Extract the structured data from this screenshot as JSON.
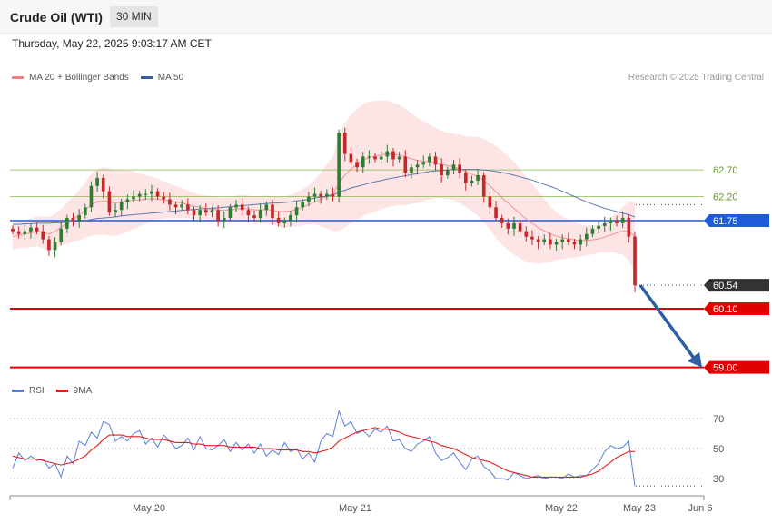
{
  "header": {
    "title": "Crude Oil (WTI)",
    "interval": "30 MIN",
    "datetime": "Thursday, May 22, 2025 9:03:17 AM CET"
  },
  "legend": {
    "ma20": "MA 20 + Bollinger Bands",
    "ma50": "MA 50",
    "ma20_color": "#f08080",
    "ma50_color": "#3a5fa0",
    "credit": "Research © 2025 Trading Central"
  },
  "rsi_legend": {
    "rsi": "RSI",
    "ma9": "9MA",
    "rsi_color": "#5b7fd6",
    "ma9_color": "#e02020"
  },
  "chart_data": [
    {
      "type": "candlestick",
      "title": "Crude Oil (WTI)",
      "interval": "30 MIN",
      "ylim": [
        58.85,
        63.95
      ],
      "x_tick_labels": [
        "May 20",
        "May 21",
        "May 22",
        "May 23",
        "Jun 6"
      ],
      "grid": false,
      "levels": [
        {
          "value": 62.7,
          "label": "62.70",
          "kind": "resistance",
          "color": "#7cb342"
        },
        {
          "value": 62.2,
          "label": "62.20",
          "kind": "resistance",
          "color": "#7cb342"
        },
        {
          "value": 61.75,
          "label": "61.75",
          "kind": "pivot",
          "color": "#1e5bd8"
        },
        {
          "value": 60.54,
          "label": "60.54",
          "kind": "last_price",
          "color": "#333333"
        },
        {
          "value": 60.1,
          "label": "60.10",
          "kind": "support",
          "color": "#e00000"
        },
        {
          "value": 59.0,
          "label": "59.00",
          "kind": "support",
          "color": "#e00000"
        }
      ],
      "close_series": [
        61.55,
        61.5,
        61.55,
        61.62,
        61.55,
        61.4,
        61.2,
        61.35,
        61.6,
        61.8,
        61.75,
        61.85,
        62.0,
        62.4,
        62.55,
        62.3,
        61.9,
        61.95,
        62.1,
        62.15,
        62.2,
        62.25,
        62.25,
        62.3,
        62.2,
        62.15,
        62.05,
        62.0,
        62.05,
        61.95,
        61.85,
        61.95,
        61.9,
        61.95,
        61.75,
        61.8,
        62.0,
        62.05,
        61.95,
        61.85,
        61.8,
        61.95,
        62.05,
        61.8,
        61.7,
        61.75,
        61.85,
        62.0,
        62.1,
        62.2,
        62.25,
        62.2,
        62.25,
        62.2,
        63.4,
        63.0,
        62.85,
        62.75,
        62.95,
        62.95,
        62.9,
        62.95,
        63.05,
        62.9,
        62.95,
        62.65,
        62.75,
        62.8,
        62.85,
        62.95,
        62.8,
        62.6,
        62.7,
        62.8,
        62.65,
        62.45,
        62.5,
        62.6,
        62.2,
        62.0,
        61.8,
        61.7,
        61.6,
        61.7,
        61.55,
        61.45,
        61.4,
        61.35,
        61.4,
        61.3,
        61.35,
        61.4,
        61.35,
        61.3,
        61.4,
        61.5,
        61.6,
        61.65,
        61.7,
        61.75,
        61.7,
        61.8,
        61.45,
        60.54
      ],
      "ma20": [
        61.45,
        61.48,
        61.5,
        61.52,
        61.55,
        61.53,
        61.5,
        61.55,
        61.62,
        61.7,
        61.78,
        61.85,
        61.95,
        62.05,
        62.1,
        62.12,
        62.1,
        62.08,
        62.1,
        62.12,
        62.13,
        62.14,
        62.15,
        62.16,
        62.15,
        62.14,
        62.12,
        62.1,
        62.08,
        62.05,
        62.02,
        62.0,
        61.98,
        61.97,
        61.95,
        61.94,
        61.95,
        61.97,
        61.98,
        61.97,
        61.95,
        61.95,
        61.96,
        61.94,
        61.92,
        61.92,
        61.93,
        61.96,
        62.0,
        62.05,
        62.1,
        62.15,
        62.2,
        62.25,
        62.45,
        62.6,
        62.72,
        62.8,
        62.88,
        62.93,
        62.96,
        62.98,
        63.0,
        62.99,
        62.98,
        62.94,
        62.91,
        62.88,
        62.86,
        62.85,
        62.83,
        62.8,
        62.78,
        62.76,
        62.72,
        62.67,
        62.62,
        62.58,
        62.5,
        62.4,
        62.29,
        62.18,
        62.08,
        61.98,
        61.88,
        61.78,
        61.7,
        61.62,
        61.56,
        61.5,
        61.46,
        61.43,
        61.41,
        61.39,
        61.38,
        61.38,
        61.39,
        61.41,
        61.44,
        61.48,
        61.52,
        61.56,
        61.55,
        61.45
      ],
      "ma50": [
        61.68,
        61.68,
        61.69,
        61.69,
        61.7,
        61.7,
        61.7,
        61.71,
        61.71,
        61.72,
        61.73,
        61.74,
        61.75,
        61.77,
        61.79,
        61.8,
        61.81,
        61.82,
        61.84,
        61.85,
        61.86,
        61.87,
        61.88,
        61.89,
        61.9,
        61.91,
        61.92,
        61.93,
        61.94,
        61.95,
        61.96,
        61.97,
        61.97,
        61.98,
        61.99,
        62.0,
        62.01,
        62.02,
        62.03,
        62.04,
        62.05,
        62.06,
        62.07,
        62.08,
        62.08,
        62.09,
        62.1,
        62.12,
        62.13,
        62.15,
        62.17,
        62.19,
        62.21,
        62.23,
        62.28,
        62.32,
        62.36,
        62.39,
        62.42,
        62.45,
        62.48,
        62.5,
        62.53,
        62.55,
        62.57,
        62.59,
        62.61,
        62.63,
        62.65,
        62.67,
        62.68,
        62.69,
        62.7,
        62.71,
        62.71,
        62.71,
        62.71,
        62.71,
        62.7,
        62.69,
        62.67,
        62.65,
        62.63,
        62.6,
        62.57,
        62.54,
        62.51,
        62.47,
        62.43,
        62.39,
        62.35,
        62.3,
        62.25,
        62.2,
        62.15,
        62.1,
        62.06,
        62.02,
        61.98,
        61.95,
        61.92,
        61.89,
        61.86,
        61.82
      ],
      "bb_width": [
        0.25,
        0.25,
        0.26,
        0.27,
        0.28,
        0.3,
        0.32,
        0.33,
        0.35,
        0.38,
        0.42,
        0.47,
        0.52,
        0.58,
        0.62,
        0.63,
        0.63,
        0.62,
        0.6,
        0.57,
        0.54,
        0.5,
        0.46,
        0.42,
        0.38,
        0.35,
        0.32,
        0.3,
        0.28,
        0.26,
        0.25,
        0.24,
        0.24,
        0.24,
        0.24,
        0.24,
        0.24,
        0.25,
        0.25,
        0.25,
        0.25,
        0.26,
        0.26,
        0.27,
        0.28,
        0.29,
        0.3,
        0.32,
        0.34,
        0.37,
        0.42,
        0.5,
        0.6,
        0.7,
        0.9,
        0.98,
        1.02,
        1.04,
        1.05,
        1.05,
        1.04,
        1.02,
        1.0,
        0.97,
        0.94,
        0.9,
        0.85,
        0.8,
        0.75,
        0.7,
        0.66,
        0.63,
        0.62,
        0.62,
        0.64,
        0.66,
        0.7,
        0.74,
        0.78,
        0.82,
        0.86,
        0.88,
        0.88,
        0.87,
        0.84,
        0.8,
        0.74,
        0.68,
        0.6,
        0.52,
        0.45,
        0.4,
        0.36,
        0.33,
        0.3,
        0.28,
        0.27,
        0.26,
        0.28,
        0.32,
        0.38,
        0.45,
        0.55,
        0.65
      ]
    },
    {
      "type": "line",
      "title": "RSI",
      "ylim": [
        20,
        80
      ],
      "y_ticks": [
        30,
        50,
        70
      ],
      "series": [
        {
          "name": "RSI",
          "color": "#5b7fd6",
          "values": [
            37,
            47,
            42,
            45,
            42,
            43,
            37,
            40,
            31,
            45,
            40,
            55,
            52,
            61,
            57,
            68,
            66,
            55,
            58,
            55,
            60,
            62,
            53,
            57,
            51,
            59,
            55,
            50,
            52,
            57,
            49,
            58,
            50,
            49,
            52,
            56,
            48,
            54,
            49,
            53,
            47,
            53,
            45,
            49,
            46,
            54,
            48,
            50,
            43,
            47,
            41,
            55,
            60,
            58,
            75,
            65,
            68,
            60,
            62,
            58,
            63,
            61,
            65,
            55,
            56,
            50,
            48,
            53,
            55,
            58,
            47,
            42,
            44,
            47,
            41,
            36,
            43,
            45,
            38,
            35,
            30,
            30,
            29,
            34,
            32,
            30,
            31,
            32,
            30,
            31,
            31,
            30,
            33,
            31,
            32,
            32,
            36,
            40,
            48,
            52,
            50,
            51,
            55,
            25
          ]
        },
        {
          "name": "9MA",
          "color": "#e02020",
          "values": [
            45,
            44,
            43,
            43,
            43,
            42,
            41,
            40,
            39,
            40,
            41,
            43,
            45,
            49,
            52,
            56,
            59,
            59,
            59,
            58,
            58,
            58,
            57,
            56,
            56,
            56,
            55,
            54,
            54,
            54,
            53,
            53,
            52,
            52,
            52,
            52,
            51,
            51,
            51,
            51,
            51,
            50,
            50,
            50,
            49,
            49,
            49,
            49,
            48,
            48,
            47,
            48,
            49,
            51,
            55,
            57,
            59,
            61,
            62,
            63,
            64,
            63,
            63,
            62,
            61,
            59,
            58,
            57,
            56,
            55,
            54,
            52,
            51,
            50,
            48,
            46,
            44,
            43,
            42,
            41,
            39,
            37,
            35,
            34,
            33,
            32,
            31,
            31,
            31,
            31,
            31,
            31,
            31,
            31,
            31,
            32,
            33,
            35,
            38,
            41,
            44,
            46,
            48,
            48
          ]
        }
      ]
    }
  ]
}
